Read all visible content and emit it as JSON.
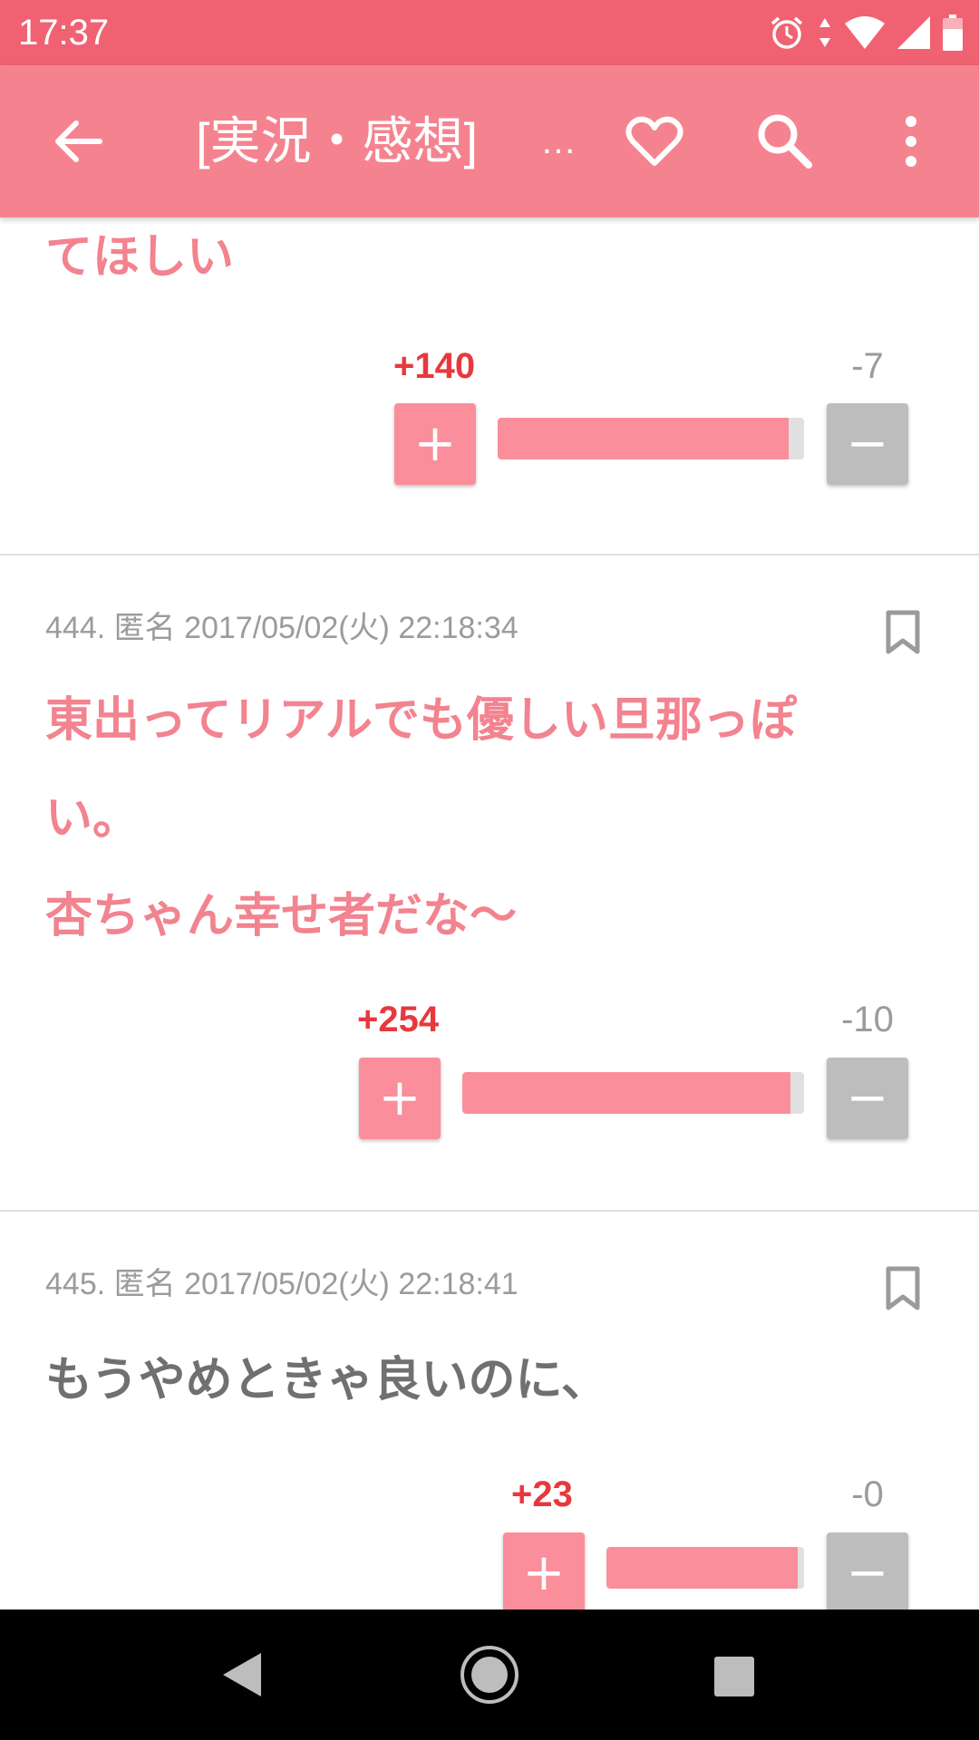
{
  "status_bar": {
    "time": "17:37"
  },
  "app_bar": {
    "title": "[実況・感想]",
    "ellipsis": "…"
  },
  "posts": [
    {
      "body_lines": [
        "てほしい"
      ],
      "plus": "+140",
      "minus": "-7",
      "plus_ratio": 0.95
    },
    {
      "meta": "444. 匿名 2017/05/02(火) 22:18:34",
      "body_lines": [
        "東出ってリアルでも優しい旦那っぽ",
        "い。",
        "杏ちゃん幸せ者だな〜"
      ],
      "plus": "+254",
      "minus": "-10",
      "plus_ratio": 0.96
    },
    {
      "meta": "445. 匿名 2017/05/02(火) 22:18:41",
      "body_lines": [
        "もうやめときゃ良いのに、"
      ],
      "plus": "+23",
      "minus": "-0",
      "plus_ratio": 0.97
    }
  ],
  "icons": {
    "back": "arrow-left-icon",
    "favorite": "heart-icon",
    "search": "search-icon",
    "more": "more-vert-icon",
    "bookmark": "bookmark-icon"
  },
  "colors": {
    "status_bar": "#f06272",
    "app_bar": "#f5838f",
    "accent": "#fa8e9a",
    "plus_text": "#e8383d"
  }
}
